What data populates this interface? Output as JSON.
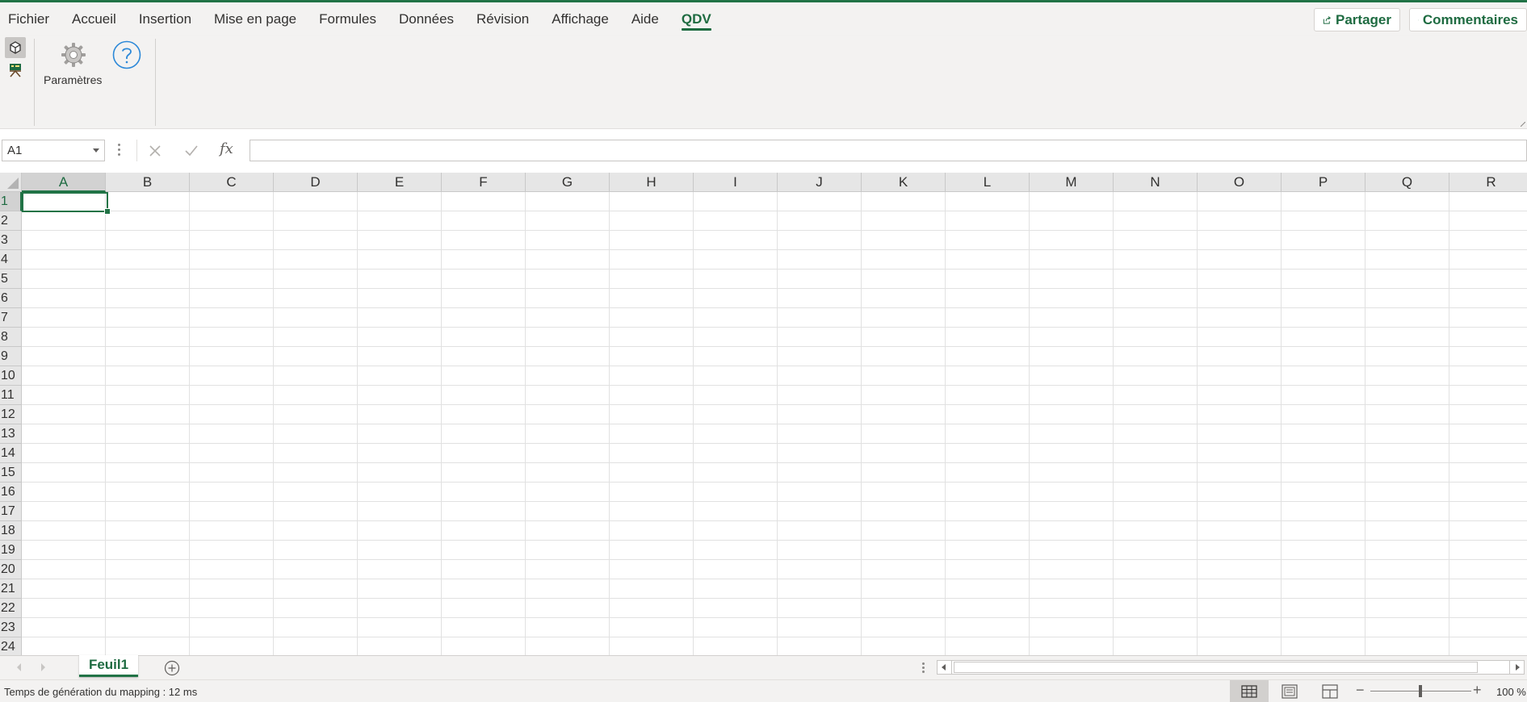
{
  "menu": {
    "tabs": [
      {
        "label": "Fichier"
      },
      {
        "label": "Accueil"
      },
      {
        "label": "Insertion"
      },
      {
        "label": "Mise en page"
      },
      {
        "label": "Formules"
      },
      {
        "label": "Données"
      },
      {
        "label": "Révision"
      },
      {
        "label": "Affichage"
      },
      {
        "label": "Aide"
      },
      {
        "label": "QDV"
      }
    ],
    "active_tab": "QDV",
    "share_label": "Partager",
    "comments_label": "Commentaires"
  },
  "ribbon": {
    "parametres_label": "Paramètres",
    "icons": [
      "addin-cube-icon",
      "addin-small-icon",
      "gear-icon",
      "help-circle-icon"
    ]
  },
  "formula_bar": {
    "name_box": "A1",
    "fx_label": "fx",
    "formula_value": ""
  },
  "grid": {
    "columns": [
      "A",
      "B",
      "C",
      "D",
      "E",
      "F",
      "G",
      "H",
      "I",
      "J",
      "K",
      "L",
      "M",
      "N",
      "O",
      "P",
      "Q",
      "R"
    ],
    "rows": [
      "1",
      "2",
      "3",
      "4",
      "5",
      "6",
      "7",
      "8",
      "9",
      "10",
      "11",
      "12",
      "13",
      "14",
      "15",
      "16",
      "17",
      "18",
      "19",
      "20",
      "21",
      "22",
      "23",
      "24"
    ],
    "selected_cell": "A1"
  },
  "sheets": {
    "tabs": [
      {
        "label": "Feuil1"
      }
    ],
    "active": "Feuil1"
  },
  "status": {
    "message": "Temps de génération du mapping : 12 ms",
    "zoom_label": "100 %",
    "zoom_minus": "−",
    "zoom_plus": "+"
  },
  "colors": {
    "accent": "#217346",
    "accent_text": "#1e6b41",
    "chrome_bg": "#f3f2f1",
    "header_bg": "#e6e6e6"
  }
}
